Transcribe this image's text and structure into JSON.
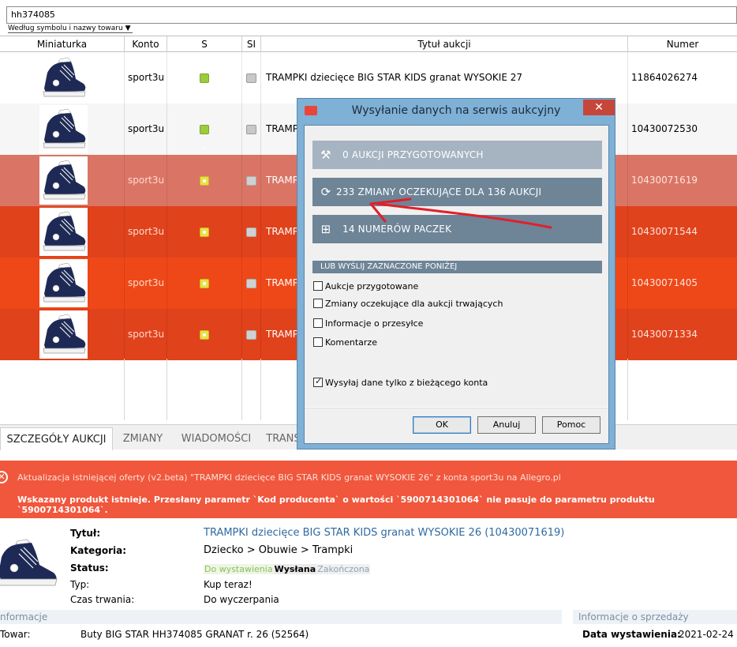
{
  "search": {
    "value": "hh374085",
    "sort_label": "Według symbolu i nazwy towaru"
  },
  "columns": [
    "Miniaturka",
    "Konto",
    "S",
    "SI",
    "Tytuł aukcji",
    "Numer"
  ],
  "rows": [
    {
      "account": "sport3u",
      "status": "ok",
      "title": "TRAMPKI dziecięce BIG STAR KIDS granat WYSOKIE 27",
      "number": "11864026274",
      "bg": "#ffffff"
    },
    {
      "account": "sport3u",
      "status": "ok",
      "title": "TRAMPKI dziecięce BIG STAR KIDS granat WYSOKIE 28",
      "number": "10430072530",
      "bg": "#f6f6f6"
    },
    {
      "account": "sport3u",
      "status": "pending",
      "title": "TRAMPKI dziecięce BIG STAR KIDS granat WYSOKIE 26",
      "number": "10430071619",
      "bg": "#da7566"
    },
    {
      "account": "sport3u",
      "status": "pending",
      "title": "TRAMPKI dziecięce BIG STAR KIDS granat WYSOKIE 29",
      "number": "10430071544",
      "bg": "#e0421c"
    },
    {
      "account": "sport3u",
      "status": "pending",
      "title": "TRAMPKI dziecięce BIG STAR KIDS granat WYSOKIE 30",
      "number": "10430071405",
      "bg": "#ef4818"
    },
    {
      "account": "sport3u",
      "status": "pending",
      "title": "TRAMPKI dziecięce BIG STAR KIDS granat WYSOKIE 31",
      "number": "10430071334",
      "bg": "#e0421c"
    }
  ],
  "tabs": [
    "SZCZEGÓŁY AUKCJI",
    "ZMIANY",
    "WIADOMOŚCI",
    "TRANS"
  ],
  "error": {
    "line1": "Aktualizacja istniejącej oferty (v2.beta) \"TRAMPKI dziecięce BIG STAR KIDS granat WYSOKIE 26\" z konta sport3u na Allegro.pl",
    "line2": "Wskazany produkt istnieje. Przesłany parametr `Kod producenta` o wartości `5900714301064` nie pasuje do parametru produktu `5900714301064`."
  },
  "details": {
    "title_label": "Tytuł:",
    "title_value": "TRAMPKI dziecięce BIG STAR KIDS granat WYSOKIE 26 (10430071619)",
    "category_label": "Kategoria:",
    "category_value": "Dziecko > Obuwie > Trampki",
    "status_label": "Status:",
    "status_chips": [
      "Do wystawienia",
      "Wysłana",
      "Zakończona"
    ],
    "type_label": "Typ:",
    "type_value": "Kup teraz!",
    "duration_label": "Czas trwania:",
    "duration_value": "Do wyczerpania"
  },
  "info": {
    "header": "nformacje",
    "towar_label": "Towar:",
    "towar_value": "Buty BIG STAR HH374085 GRANAT r. 26 (52564)",
    "sale_header": "Informacje o sprzedaży",
    "sale_date_label": "Data wystawienia:",
    "sale_date_value": "2021-02-24"
  },
  "dialog": {
    "title": "Wysyłanie danych na serwis aukcyjny",
    "btn_prepared": "0 AUKCJI PRZYGOTOWANYCH",
    "btn_changes": "233 ZMIANY OCZEKUJĄCE DLA 136 AUKCJI",
    "btn_parcels": "14 NUMERÓW PACZEK",
    "or_label": "LUB WYŚLIJ ZAZNACZONE PONIŻEJ",
    "checkboxes": [
      "Aukcje przygotowane",
      "Zmiany oczekujące dla aukcji trwających",
      "Informacje o przesyłce",
      "Komentarze"
    ],
    "only_current": "Wysyłaj dane tylko z bieżącego konta",
    "ok": "OK",
    "cancel": "Anuluj",
    "help": "Pomoc"
  },
  "colors": {
    "error_bg": "#f0573c",
    "dialog_frame": "#7fb0d6",
    "button_slate": "#6e8497",
    "arrow": "#e0202a"
  }
}
